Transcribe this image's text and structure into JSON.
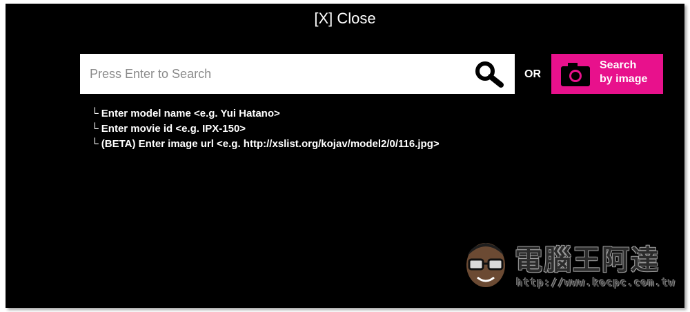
{
  "overlay": {
    "close_label": "[X] Close"
  },
  "search": {
    "placeholder": "Press Enter to Search",
    "value": "",
    "icon": "magnifier-icon"
  },
  "divider_label": "OR",
  "image_search": {
    "label_line1": "Search",
    "label_line2": "by image",
    "icon": "camera-icon",
    "color": "#e8118c"
  },
  "hints": [
    "└ Enter model name <e.g. Yui Hatano>",
    "└ Enter movie id <e.g. IPX-150>",
    "└ (BETA) Enter image url <e.g. http://xslist.org/kojav/model2/0/116.jpg>"
  ],
  "watermark": {
    "title": "電腦王阿達",
    "url": "http://www.kocpc.com.tw"
  }
}
